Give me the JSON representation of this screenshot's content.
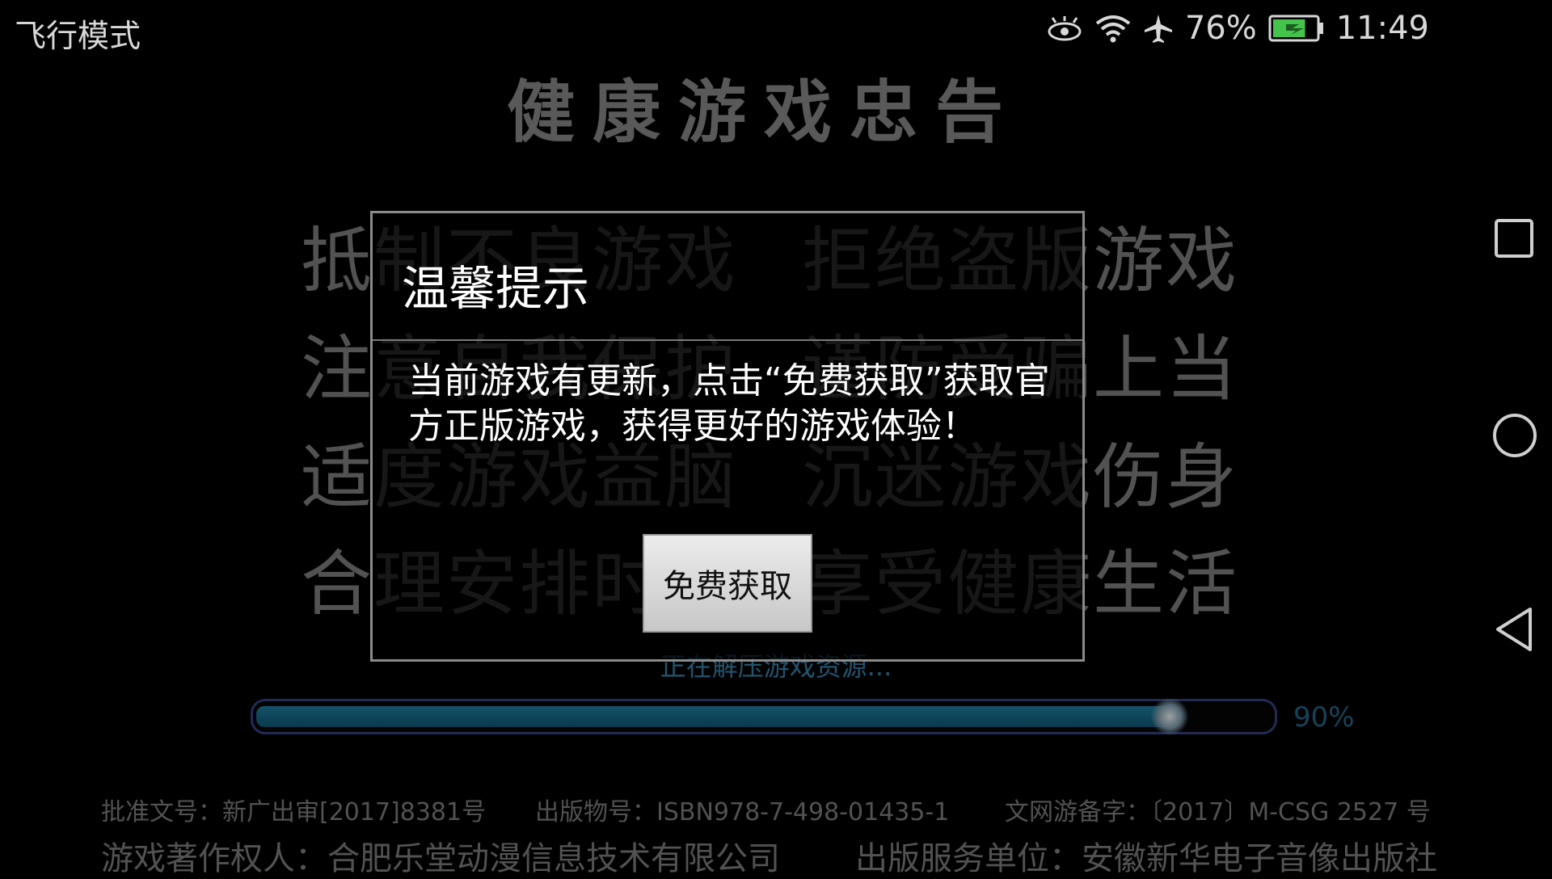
{
  "statusbar": {
    "mode_text": "飞行模式",
    "battery_percent": "76%",
    "time": "11:49",
    "battery_level": 0.76,
    "icons": [
      "eye-icon",
      "wifi-icon",
      "airplane-icon",
      "battery-charging-icon"
    ]
  },
  "game": {
    "title": "健康游戏忠告",
    "advice": [
      [
        "抵制不良游戏",
        "拒绝盗版游戏"
      ],
      [
        "注意自我保护",
        "谨防受骗上当"
      ],
      [
        "适度游戏益脑",
        "沉迷游戏伤身"
      ],
      [
        "合理安排时间",
        "享受健康生活"
      ]
    ],
    "loading_text": "正在解压游戏资源...",
    "progress_percent": "90%",
    "progress_value": 0.9,
    "footer": {
      "approval": "批准文号：新广出审[2017]8381号",
      "isbn": "出版物号：ISBN978-7-498-01435-1",
      "record": "文网游备字：〔2017〕M-CSG 2527 号",
      "copyright": "游戏著作权人：合肥乐堂动漫信息技术有限公司",
      "publisher": "出版服务单位：安徽新华电子音像出版社"
    }
  },
  "dialog": {
    "title": "温馨提示",
    "message": "当前游戏有更新，点击“免费获取”获取官方正版游戏，获得更好的游戏体验！",
    "button_label": "免费获取"
  },
  "navbar": {
    "icons": [
      "recent-apps-icon",
      "home-icon",
      "back-icon"
    ]
  }
}
